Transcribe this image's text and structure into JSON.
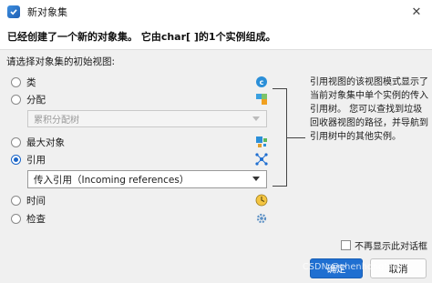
{
  "window": {
    "title": "新对象集",
    "app_icon": "check-app-icon",
    "close_glyph": "✕"
  },
  "header": {
    "message": "已经创建了一个新的对象集。 它由char[ ]的1个实例组成。"
  },
  "prompt": "请选择对象集的初始视图:",
  "options": [
    {
      "label": "类",
      "icon": "class-icon",
      "selected": false
    },
    {
      "label": "分配",
      "icon": "allocation-icon",
      "selected": false
    },
    {
      "label": "最大对象",
      "icon": "biggest-objects-icon",
      "selected": false
    },
    {
      "label": "引用",
      "icon": "references-icon",
      "selected": true
    },
    {
      "label": "时间",
      "icon": "time-icon",
      "selected": false
    },
    {
      "label": "检查",
      "icon": "inspection-icon",
      "selected": false
    }
  ],
  "allocation_combo": {
    "value": "累积分配树",
    "enabled": false
  },
  "references_combo": {
    "value": "传入引用（Incoming references）",
    "enabled": true
  },
  "description": "引用视图的该视图模式显示了当前对象集中单个实例的传入引用树。 您可以查找到垃圾回收器视图的路径，并导航到引用树中的其他实例。",
  "dont_show_checkbox": {
    "label": "不再显示此对话框",
    "checked": false
  },
  "buttons": {
    "ok": "确定",
    "cancel": "取消"
  },
  "watermark": "CSDN @chenhongtao",
  "colors": {
    "accent": "#1f6fd1",
    "panel": "#f0f0f0",
    "header": "#ffffff"
  }
}
